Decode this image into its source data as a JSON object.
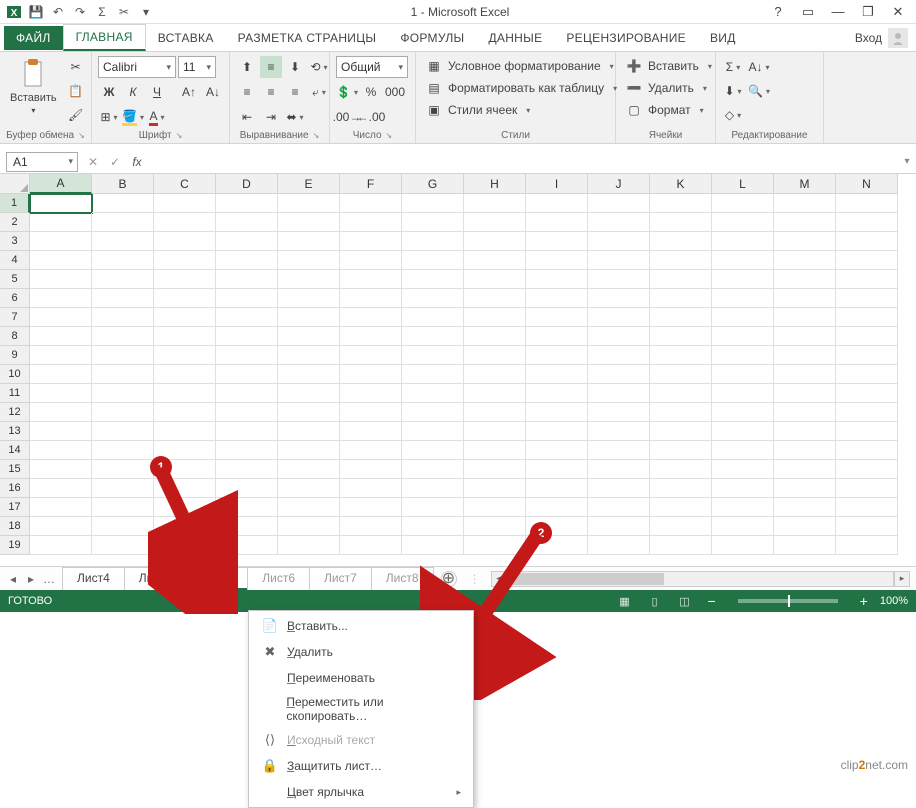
{
  "title": "1 - Microsoft Excel",
  "qat": {
    "save": "💾",
    "undo": "↶",
    "redo": "↷",
    "sum": "Σ",
    "cut": "✂"
  },
  "window_controls": {
    "help": "?",
    "ribbon_opts": "▭",
    "min": "—",
    "restore": "❐",
    "close": "✕"
  },
  "tabs": {
    "file": "ФАЙЛ",
    "items": [
      "ГЛАВНАЯ",
      "ВСТАВКА",
      "РАЗМЕТКА СТРАНИЦЫ",
      "ФОРМУЛЫ",
      "ДАННЫЕ",
      "РЕЦЕНЗИРОВАНИЕ",
      "ВИД"
    ],
    "active": 0,
    "signin": "Вход"
  },
  "ribbon": {
    "clipboard": {
      "label": "Буфер обмена",
      "paste": "Вставить"
    },
    "font": {
      "label": "Шрифт",
      "name": "Calibri",
      "size": "11",
      "bold": "Ж",
      "italic": "К",
      "underline": "Ч"
    },
    "alignment": {
      "label": "Выравнивание"
    },
    "number": {
      "label": "Число",
      "format": "Общий",
      "percent": "%",
      "thousands": "000"
    },
    "styles": {
      "label": "Стили",
      "cond": "Условное форматирование",
      "table": "Форматировать как таблицу",
      "cell": "Стили ячеек"
    },
    "cells": {
      "label": "Ячейки",
      "insert": "Вставить",
      "delete": "Удалить",
      "format": "Формат"
    },
    "editing": {
      "label": "Редактирование",
      "sum": "Σ",
      "fill": "⬇",
      "clear": "◇",
      "sort": "A↓",
      "find": "🔍"
    }
  },
  "formula": {
    "cellref": "A1",
    "fx": "fx",
    "cancel": "✕",
    "confirm": "✓",
    "value": ""
  },
  "grid": {
    "cols": [
      "A",
      "B",
      "C",
      "D",
      "E",
      "F",
      "G",
      "H",
      "I",
      "J",
      "K",
      "L",
      "M",
      "N"
    ],
    "rows": 19,
    "active_col": 0,
    "active_row": 0
  },
  "sheets": {
    "ellipsis": "…",
    "tabs": [
      "Лист4",
      "Лист3",
      "Лист5",
      "Лист6",
      "Лист7",
      "Лист8"
    ],
    "active": 2,
    "add": "⊕"
  },
  "status": {
    "ready": "ГОТОВО",
    "zoom": "100%",
    "minus": "−",
    "plus": "+"
  },
  "context_menu": {
    "items": [
      {
        "icon": "📄",
        "label": "Вставить...",
        "u": "В"
      },
      {
        "icon": "✖",
        "label": "Удалить",
        "u": "У"
      },
      {
        "icon": "",
        "label": "Переименовать",
        "u": "П"
      },
      {
        "icon": "",
        "label": "Переместить или скопировать…",
        "u": "П"
      },
      {
        "icon": "⟨⟩",
        "label": "Исходный текст",
        "u": "И",
        "disabled": true
      },
      {
        "icon": "🔒",
        "label": "Защитить лист…",
        "u": "З"
      },
      {
        "icon": "",
        "label": "Цвет ярлычка",
        "u": "Ц",
        "arrow": true
      }
    ]
  },
  "annotations": {
    "a1": "1",
    "a2": "2"
  },
  "watermark": {
    "pre": "clip",
    "mid": "2",
    "post": "net",
    "suffix": ".com"
  }
}
